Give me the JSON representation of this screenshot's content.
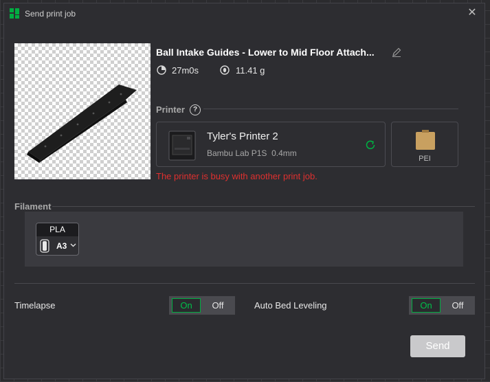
{
  "window": {
    "title": "Send print job"
  },
  "job": {
    "name": "Ball Intake Guides - Lower to Mid Floor Attach...",
    "time": "27m0s",
    "weight": "11.41 g"
  },
  "printer": {
    "section_label": "Printer",
    "name": "Tyler's Printer 2",
    "model": "Bambu Lab P1S",
    "nozzle": "0.4mm",
    "plate_label": "PEI",
    "warning": "The printer is busy with another print job."
  },
  "filament": {
    "section_label": "Filament",
    "type": "PLA",
    "slot": "A3"
  },
  "options": {
    "timelapse": {
      "label": "Timelapse",
      "on": "On",
      "off": "Off",
      "value": "on"
    },
    "bed_leveling": {
      "label": "Auto Bed Leveling",
      "on": "On",
      "off": "Off",
      "value": "on"
    }
  },
  "actions": {
    "send_label": "Send"
  },
  "colors": {
    "accent": "#00ae42",
    "warning": "#e0302f",
    "plate": "#c8a060"
  }
}
